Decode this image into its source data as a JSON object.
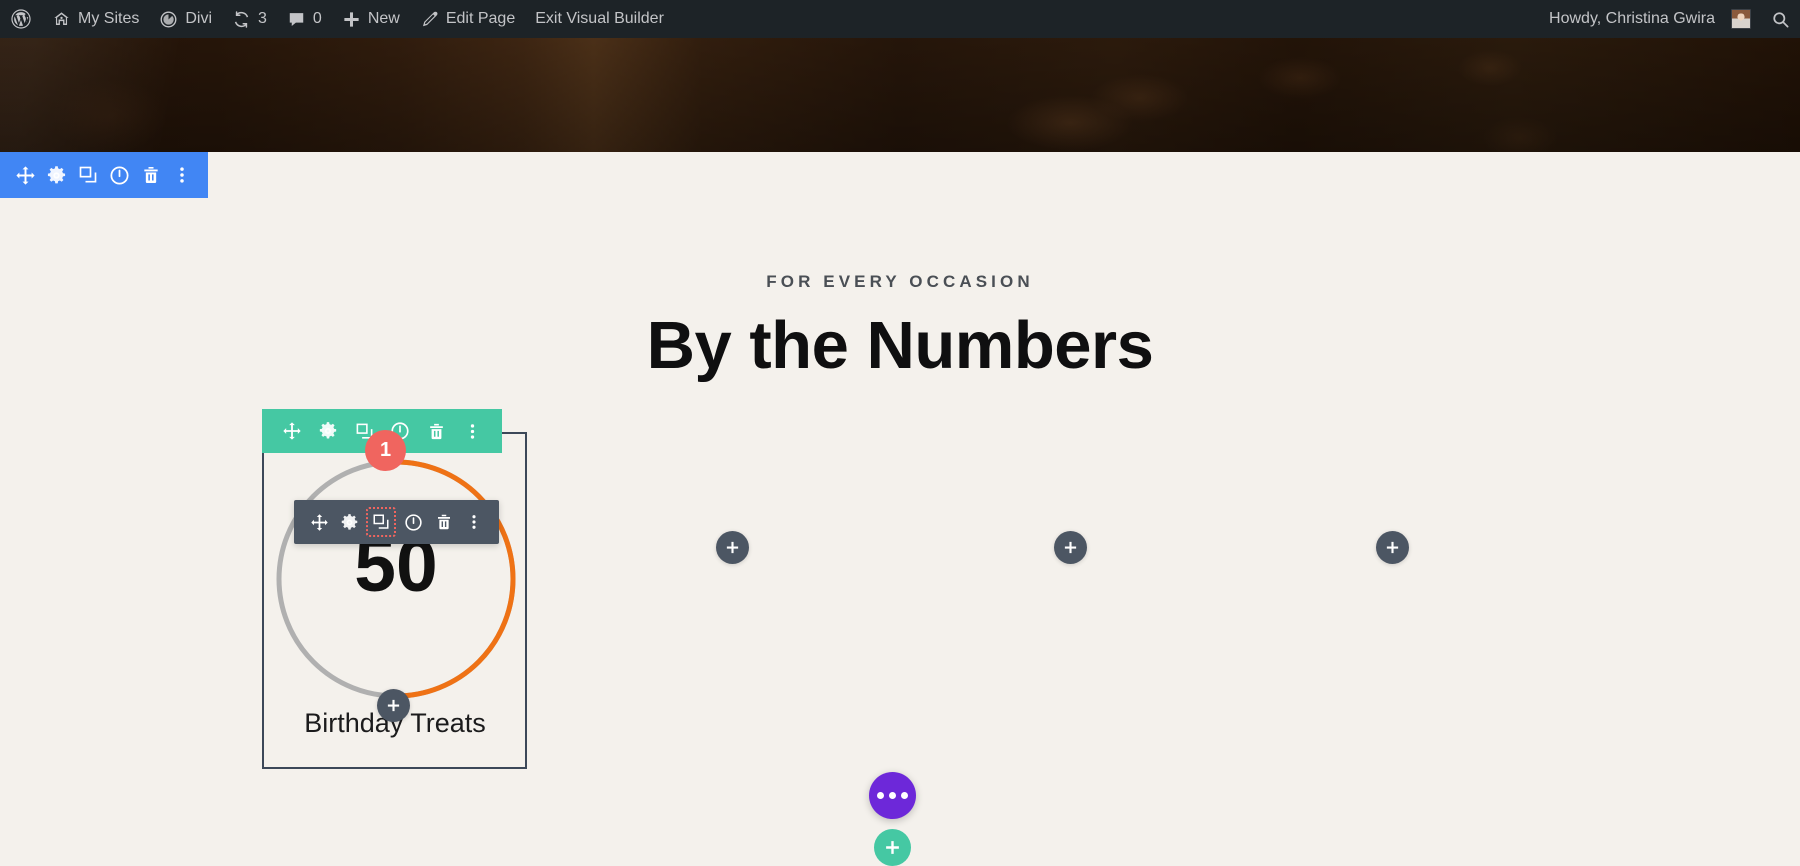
{
  "admin_bar": {
    "items": [
      {
        "id": "wp-logo",
        "icon": "wordpress-icon",
        "label": ""
      },
      {
        "id": "my-sites",
        "icon": "sites-icon",
        "label": "My Sites"
      },
      {
        "id": "divi",
        "icon": "divi-icon",
        "label": "Divi"
      },
      {
        "id": "updates",
        "icon": "updates-icon",
        "label": "3"
      },
      {
        "id": "comments",
        "icon": "comment-icon",
        "label": "0"
      },
      {
        "id": "new",
        "icon": "plus-icon",
        "label": "New"
      },
      {
        "id": "edit-page",
        "icon": "pencil-icon",
        "label": "Edit Page"
      },
      {
        "id": "exit-vb",
        "icon": "",
        "label": "Exit Visual Builder"
      }
    ],
    "greeting": "Howdy, Christina Gwira",
    "search_icon": "search-icon"
  },
  "section": {
    "toolbar": {
      "buttons": [
        {
          "name": "move-handle-icon",
          "title": "Move Section"
        },
        {
          "name": "gear-icon",
          "title": "Section Settings"
        },
        {
          "name": "duplicate-icon",
          "title": "Duplicate Section"
        },
        {
          "name": "power-icon",
          "title": "Disable Section"
        },
        {
          "name": "trash-icon",
          "title": "Delete Section"
        },
        {
          "name": "ellipsis-vertical-icon",
          "title": "More Options"
        }
      ],
      "color": "#4186f4"
    }
  },
  "content": {
    "subtitle": "FOR EVERY OCCASION",
    "title": "By the Numbers"
  },
  "row": {
    "badge": "1",
    "badge_color": "#f0655f",
    "toolbar": {
      "color": "#45c8a3",
      "buttons": [
        {
          "name": "move-handle-icon",
          "title": "Move Row"
        },
        {
          "name": "gear-icon",
          "title": "Row Settings"
        },
        {
          "name": "duplicate-icon",
          "title": "Duplicate Row"
        },
        {
          "name": "power-icon",
          "title": "Disable Row"
        },
        {
          "name": "trash-icon",
          "title": "Delete Row"
        },
        {
          "name": "ellipsis-vertical-icon",
          "title": "More Options"
        }
      ]
    }
  },
  "module": {
    "toolbar": {
      "color": "#4c5663",
      "highlighted": "duplicate-icon",
      "buttons": [
        {
          "name": "move-handle-icon",
          "title": "Move Module"
        },
        {
          "name": "gear-icon",
          "title": "Module Settings"
        },
        {
          "name": "duplicate-icon",
          "title": "Duplicate Module"
        },
        {
          "name": "power-icon",
          "title": "Disable Module"
        },
        {
          "name": "trash-icon",
          "title": "Delete Module"
        },
        {
          "name": "ellipsis-vertical-icon",
          "title": "More Options"
        }
      ]
    },
    "counter": {
      "number": "50",
      "label": "Birthday Treats",
      "percent": 50,
      "bar_color": "#ef7215",
      "track_color": "#b0b0b0"
    }
  },
  "add_buttons": {
    "icon": "plus-icon",
    "color": "#4c5663",
    "count": 4
  },
  "floating": {
    "more_icon": "ellipsis-horizontal-icon",
    "more_color": "#6d28d9",
    "add_icon": "plus-icon",
    "add_color": "#45c8a3"
  }
}
